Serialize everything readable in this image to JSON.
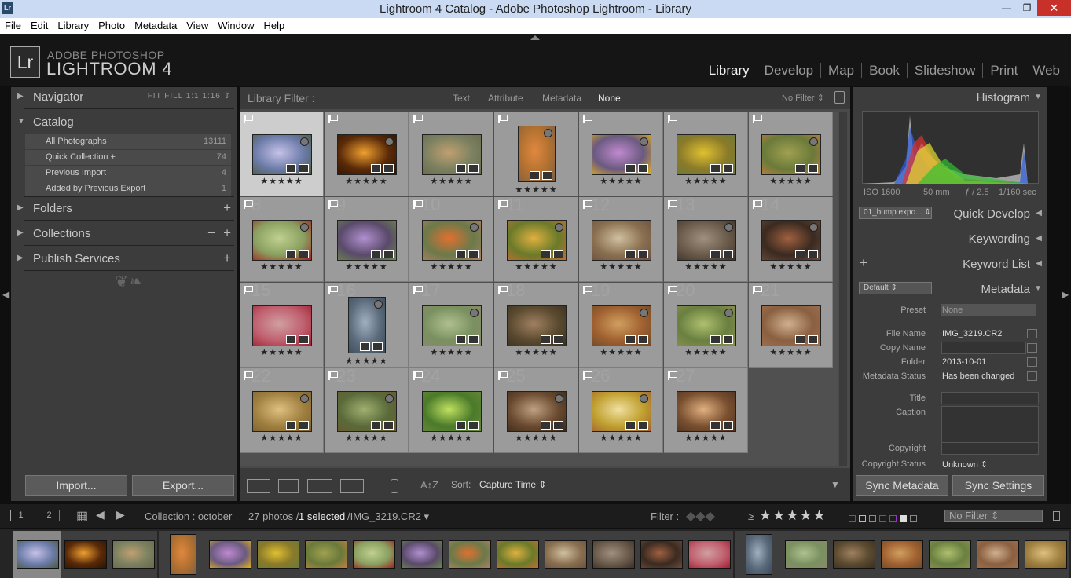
{
  "window": {
    "title": "Lightroom 4 Catalog - Adobe Photoshop Lightroom - Library",
    "icon": "Lr",
    "min": "—",
    "max": "❐",
    "close": "✕"
  },
  "menu": [
    "File",
    "Edit",
    "Library",
    "Photo",
    "Metadata",
    "View",
    "Window",
    "Help"
  ],
  "brand": {
    "logo": "Lr",
    "line1": "ADOBE PHOTOSHOP",
    "line2": "LIGHTROOM 4"
  },
  "modules": [
    "Library",
    "Develop",
    "Map",
    "Book",
    "Slideshow",
    "Print",
    "Web"
  ],
  "active_module": "Library",
  "left": {
    "navigator": {
      "label": "Navigator",
      "zoom": "FIT   FILL   1:1   1:16 ⇕"
    },
    "catalog": {
      "label": "Catalog",
      "rows": [
        {
          "name": "All Photographs",
          "count": "13111"
        },
        {
          "name": "Quick Collection +",
          "count": "74"
        },
        {
          "name": "Previous Import",
          "count": "4"
        },
        {
          "name": "Added by Previous Export",
          "count": "1"
        }
      ]
    },
    "folders": "Folders",
    "collections": "Collections",
    "publish": "Publish Services",
    "import": "Import...",
    "export": "Export..."
  },
  "filterbar": {
    "label": "Library Filter :",
    "text": "Text",
    "attribute": "Attribute",
    "metadata": "Metadata",
    "none": "None",
    "preset": "No Filter ⇕"
  },
  "grid": {
    "stars": "★★★★★",
    "cells": [
      {
        "n": "",
        "c": [
          "#6b7ba8",
          "#c6c2e8",
          "#4b5a3b"
        ]
      },
      {
        "n": "",
        "c": [
          "#5a2a08",
          "#f0a030",
          "#2a1404"
        ]
      },
      {
        "n": "",
        "c": [
          "#7a8060",
          "#c0a070",
          "#6a6a4a"
        ]
      },
      {
        "n": "",
        "c": [
          "#b07030",
          "#e08840",
          "#7a6048"
        ]
      },
      {
        "n": "",
        "c": [
          "#6a5a80",
          "#c08ad0",
          "#e0b020"
        ]
      },
      {
        "n": "",
        "c": [
          "#8a7a2a",
          "#e0c030",
          "#6a7a3a"
        ]
      },
      {
        "n": "",
        "c": [
          "#6a7a3a",
          "#a0a050",
          "#c08040"
        ]
      },
      {
        "n": "8",
        "c": [
          "#8aa060",
          "#c0d090",
          "#a02020"
        ]
      },
      {
        "n": "9",
        "c": [
          "#5a4a6a",
          "#b090d0",
          "#6a8a4a"
        ]
      },
      {
        "n": "10",
        "c": [
          "#6a7a4a",
          "#e07030",
          "#b08060"
        ]
      },
      {
        "n": "11",
        "c": [
          "#6a7a2a",
          "#e0b040",
          "#c07030"
        ]
      },
      {
        "n": "12",
        "c": [
          "#8a7050",
          "#d0c0a0",
          "#6a5040"
        ]
      },
      {
        "n": "13",
        "c": [
          "#6a5a4a",
          "#a09080",
          "#3a3028"
        ]
      },
      {
        "n": "14",
        "c": [
          "#3a2a20",
          "#a06040",
          "#6a4a3a"
        ]
      },
      {
        "n": "15",
        "c": [
          "#c06070",
          "#d0a0a0",
          "#a02030"
        ]
      },
      {
        "n": "16",
        "c": [
          "#5a6a7a",
          "#a0b0c0",
          "#3a4a5a"
        ]
      },
      {
        "n": "17",
        "c": [
          "#7a9060",
          "#b0c090",
          "#8a8a6a"
        ]
      },
      {
        "n": "18",
        "c": [
          "#5a4a30",
          "#a08060",
          "#3a3020"
        ]
      },
      {
        "n": "19",
        "c": [
          "#a06030",
          "#d0a060",
          "#6a4a2a"
        ]
      },
      {
        "n": "20",
        "c": [
          "#6a8040",
          "#b0c070",
          "#8a9050"
        ]
      },
      {
        "n": "21",
        "c": [
          "#8a6040",
          "#d0b090",
          "#a07050"
        ]
      },
      {
        "n": "22",
        "c": [
          "#a08040",
          "#e0c080",
          "#7a6030"
        ]
      },
      {
        "n": "23",
        "c": [
          "#5a6a3a",
          "#a0b070",
          "#6a5a30"
        ]
      },
      {
        "n": "24",
        "c": [
          "#4a7a2a",
          "#c0e060",
          "#6a8a3a"
        ]
      },
      {
        "n": "25",
        "c": [
          "#6a4a30",
          "#c0a080",
          "#3a2a1a"
        ]
      },
      {
        "n": "26",
        "c": [
          "#c0a030",
          "#f0e0a0",
          "#a06030"
        ]
      },
      {
        "n": "27",
        "c": [
          "#7a5030",
          "#e0b080",
          "#4a3020"
        ]
      }
    ]
  },
  "toolbar": {
    "sort_label": "Sort:",
    "sort_value": "Capture Time ⇕"
  },
  "right": {
    "histogram": "Histogram",
    "exif": {
      "iso": "ISO 1600",
      "focal": "50 mm",
      "aperture": "ƒ / 2.5",
      "shutter": "1/160 sec"
    },
    "qd_preset": "01_bump expo... ⇕",
    "quick_develop": "Quick Develop",
    "keywording": "Keywording",
    "keyword_list": "Keyword List",
    "md_preset": "Default ⇕",
    "metadata": "Metadata",
    "fields": {
      "preset_k": "Preset",
      "preset_v": "None",
      "file_k": "File Name",
      "file_v": "IMG_3219.CR2",
      "copy_k": "Copy Name",
      "folder_k": "Folder",
      "folder_v": "2013-10-01",
      "status_k": "Metadata Status",
      "status_v": "Has been changed",
      "title_k": "Title",
      "caption_k": "Caption",
      "copyright_k": "Copyright",
      "cstatus_k": "Copyright Status",
      "cstatus_v": "Unknown ⇕"
    },
    "sync_md": "Sync Metadata",
    "sync_settings": "Sync Settings"
  },
  "filmbar": {
    "collection": "Collection : october",
    "count": "27 photos /",
    "selected": "1 selected",
    "file": "/IMG_3219.CR2 ▾",
    "filter_label": "Filter :",
    "gte": "≥",
    "stars": "★★★★★",
    "nofilter": "No Filter ⇕",
    "screen1": "1",
    "screen2": "2"
  }
}
